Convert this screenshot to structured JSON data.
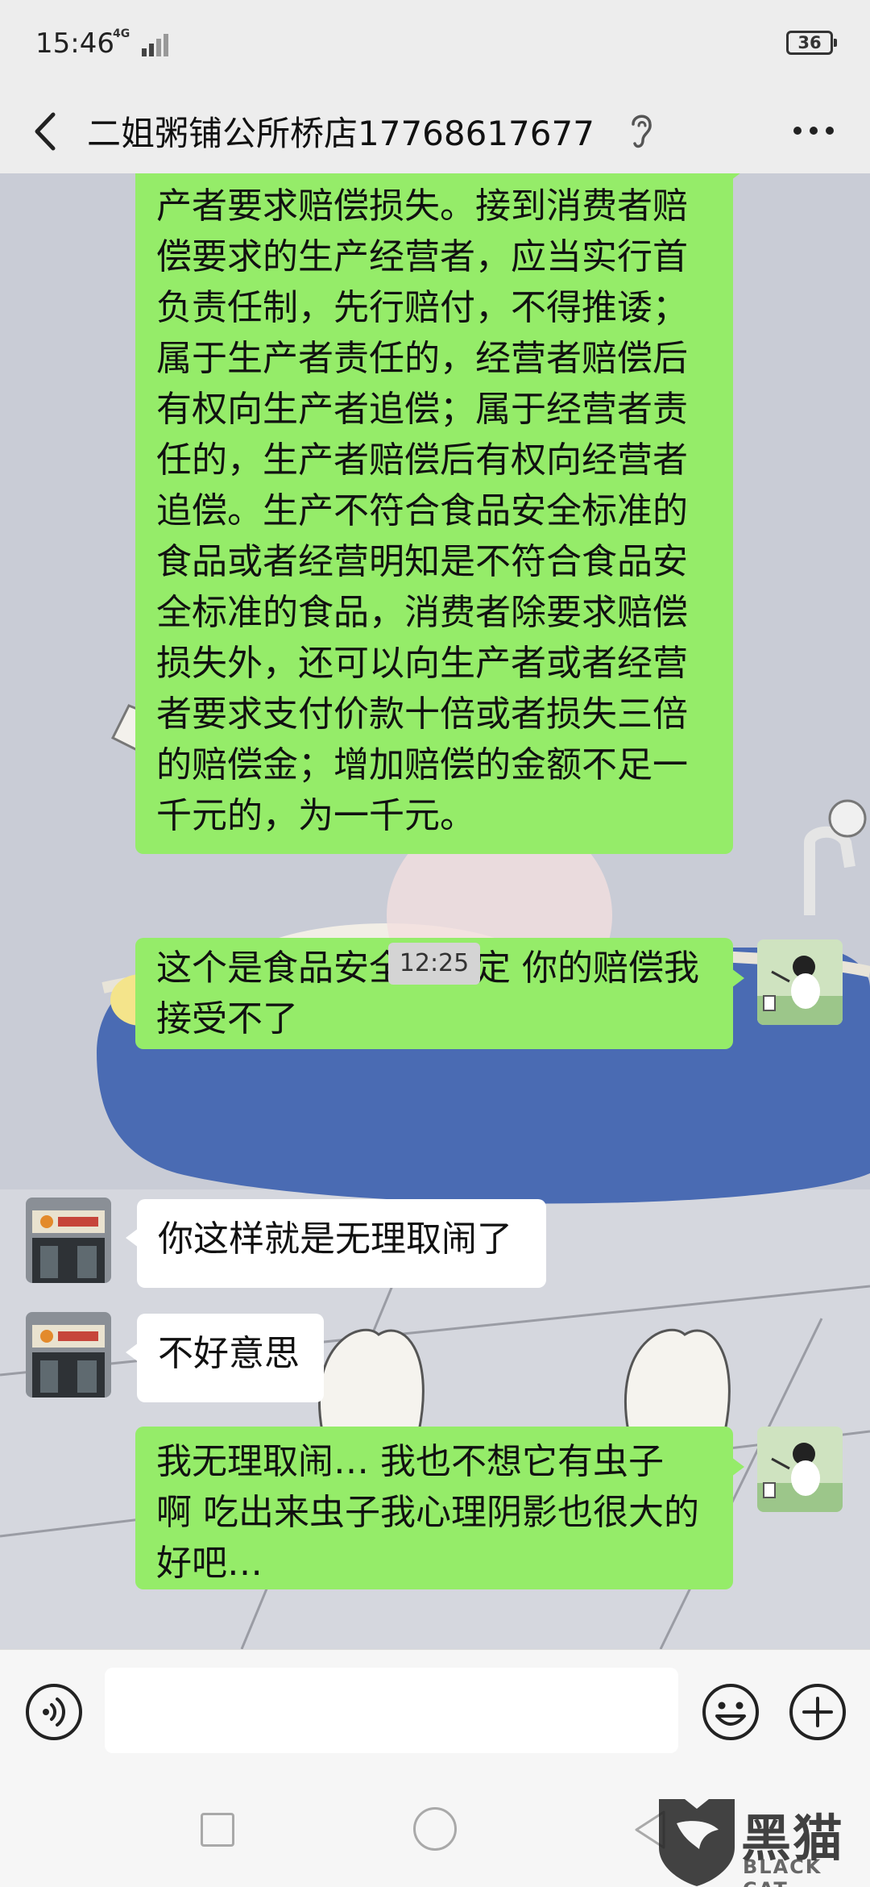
{
  "status_bar": {
    "time": "15:46",
    "network": "4G",
    "battery": "36"
  },
  "header": {
    "title": "二姐粥铺公所桥店17768617677"
  },
  "messages": [
    {
      "direction": "sent",
      "text": "经营者要求赔偿损失，也可以向生\n产者要求赔偿损失。接到消费者赔\n偿要求的生产经营者，应当实行首\n负责任制，先行赔付，不得推诿；\n属于生产者责任的，经营者赔偿后\n有权向生产者追偿；属于经营者责\n任的，生产者赔偿后有权向经营者\n追偿。生产不符合食品安全标准的\n食品或者经营明知是不符合食品安\n全标准的食品，消费者除要求赔偿\n损失外，还可以向生产者或者经营\n者要求支付价款十倍或者损失三倍\n的赔偿金；增加赔偿的金额不足一\n千元的，为一千元。"
    },
    {
      "direction": "sent",
      "text": "这个是食品安全法规定  你的赔偿我\n接受不了"
    },
    {
      "direction": "recv",
      "text": "你这样就是无理取闹了"
    },
    {
      "direction": "recv",
      "text": "不好意思"
    },
    {
      "direction": "sent",
      "text": "我无理取闹…  我也不想它有虫子\n啊  吃出来虫子我心理阴影也很大的\n好吧…"
    }
  ],
  "timestamp": "12:25",
  "input": {
    "value": "",
    "placeholder": ""
  },
  "watermark": {
    "big": "黑猫",
    "small": "BLACK CAT"
  },
  "colors": {
    "sent_bubble": "#95ec69",
    "recv_bubble": "#ffffff",
    "bar_bg": "#ededed"
  }
}
